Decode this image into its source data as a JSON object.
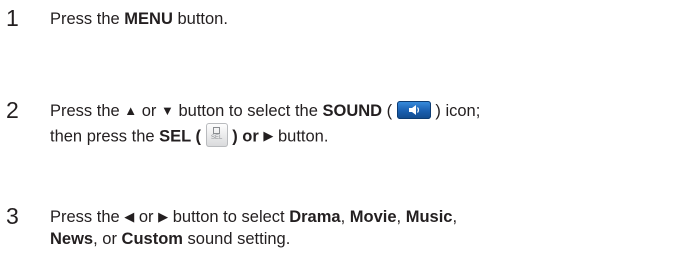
{
  "steps": [
    {
      "number": "1",
      "parts": [
        "Press the ",
        "MENU",
        " button."
      ]
    },
    {
      "number": "2",
      "line1": [
        "Press the ",
        "▲",
        " or ",
        "▼",
        " button to select the ",
        "SOUND",
        " (",
        ") icon;"
      ],
      "line2": [
        "then press the ",
        "SEL (",
        ") or ",
        "▶",
        " button."
      ],
      "sel_icon_label": "SEL"
    },
    {
      "number": "3",
      "line1": [
        "Press the ",
        "◀",
        " or ",
        "▶",
        " button to select ",
        "Drama",
        ", ",
        "Movie",
        ", ",
        "Music",
        ","
      ],
      "line2": [
        "News",
        ", or ",
        "Custom",
        " sound setting."
      ]
    }
  ],
  "icons": {
    "sound": "speaker-icon",
    "sel": "sel-button-icon",
    "up": "up-triangle-icon",
    "down": "down-triangle-icon",
    "left": "left-triangle-icon",
    "right": "right-triangle-icon"
  },
  "colors": {
    "text": "#231f20",
    "sound_icon_blue": "#1a5fb0"
  }
}
